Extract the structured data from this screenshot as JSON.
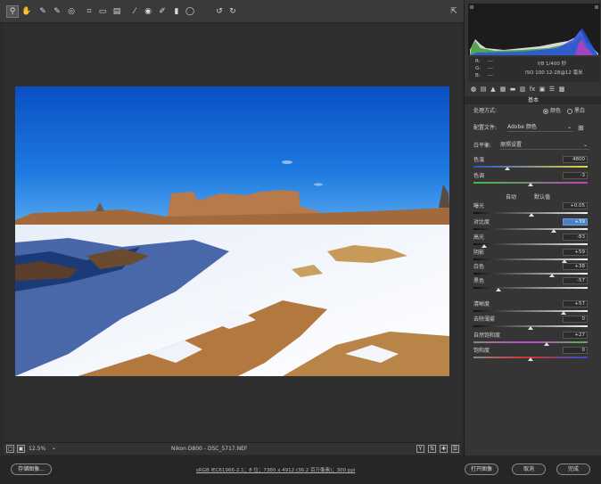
{
  "toolbar": {
    "tools": [
      "zoom-icon",
      "hand-icon",
      "white-balance-icon",
      "color-sampler-icon",
      "target-adjust-icon",
      "crop-icon",
      "straighten-icon",
      "transform-icon",
      "spot-removal-icon",
      "red-eye-icon",
      "adjustment-brush-icon",
      "graduated-filter-icon",
      "radial-filter-icon",
      "rotate-left-icon",
      "rotate-right-icon"
    ],
    "tool_glyphs": [
      "⚲",
      "✋",
      "✎",
      "✎",
      "◎",
      "⌗",
      "▭",
      "▤",
      "⁄",
      "◉",
      "✐",
      "▮",
      "◯",
      "↺",
      "↻"
    ],
    "right_glyph": "⇱"
  },
  "readout": {
    "r_label": "R:",
    "r_value": "---",
    "g_label": "G:",
    "g_value": "---",
    "b_label": "B:",
    "b_value": "---",
    "camera_line1": "f/8  1/400 秒",
    "camera_line2": "ISO 100  12-28@12 毫米"
  },
  "panel_tabs": [
    "◍",
    "▤",
    "▲",
    "▦",
    "▬",
    "▥",
    "fx",
    "▣",
    "☰",
    "▩"
  ],
  "basic": {
    "section_title": "基本",
    "process_label": "处理方式:",
    "process_color": "颜色",
    "process_bw": "黑白",
    "profile_label": "配置文件:",
    "profile_value": "Adobe 颜色",
    "wb_label": "白平衡:",
    "wb_value": "原照设置",
    "auto_link": "自动",
    "default_link": "默认值",
    "sliders": [
      {
        "label": "色温",
        "value": "4800"
      },
      {
        "label": "色调",
        "value": "-3"
      },
      {
        "label": "曝光",
        "value": "+0.05"
      },
      {
        "label": "对比度",
        "value": "+39"
      },
      {
        "label": "高光",
        "value": "-83"
      },
      {
        "label": "阴影",
        "value": "+59"
      },
      {
        "label": "白色",
        "value": "+38"
      },
      {
        "label": "黑色",
        "value": "-57"
      },
      {
        "label": "清晰度",
        "value": "+57"
      },
      {
        "label": "去除薄雾",
        "value": "0"
      },
      {
        "label": "自然饱和度",
        "value": "+27"
      },
      {
        "label": "饱和度",
        "value": "0"
      }
    ]
  },
  "slider_levels": [
    0.3,
    0.5,
    0.51,
    0.7,
    0.09,
    0.8,
    0.69,
    0.22,
    0.79,
    0.5,
    0.64,
    0.5
  ],
  "bottombar": {
    "zoom": "12.5%",
    "filename": "Nikon D800 - DSC_5717.NEF",
    "y_btn": "Y"
  },
  "footer": {
    "save_label": "存储图像...",
    "info": "sRGB IEC61966-2.1；8 位；7360 x 4912 (36.2 百万像素)；300 ppi",
    "open_label": "打开图像",
    "cancel_label": "取消",
    "done_label": "完成"
  },
  "colors": {
    "accent": "#4b7fc8",
    "panel": "#353535",
    "sky": "#1a63c9"
  }
}
